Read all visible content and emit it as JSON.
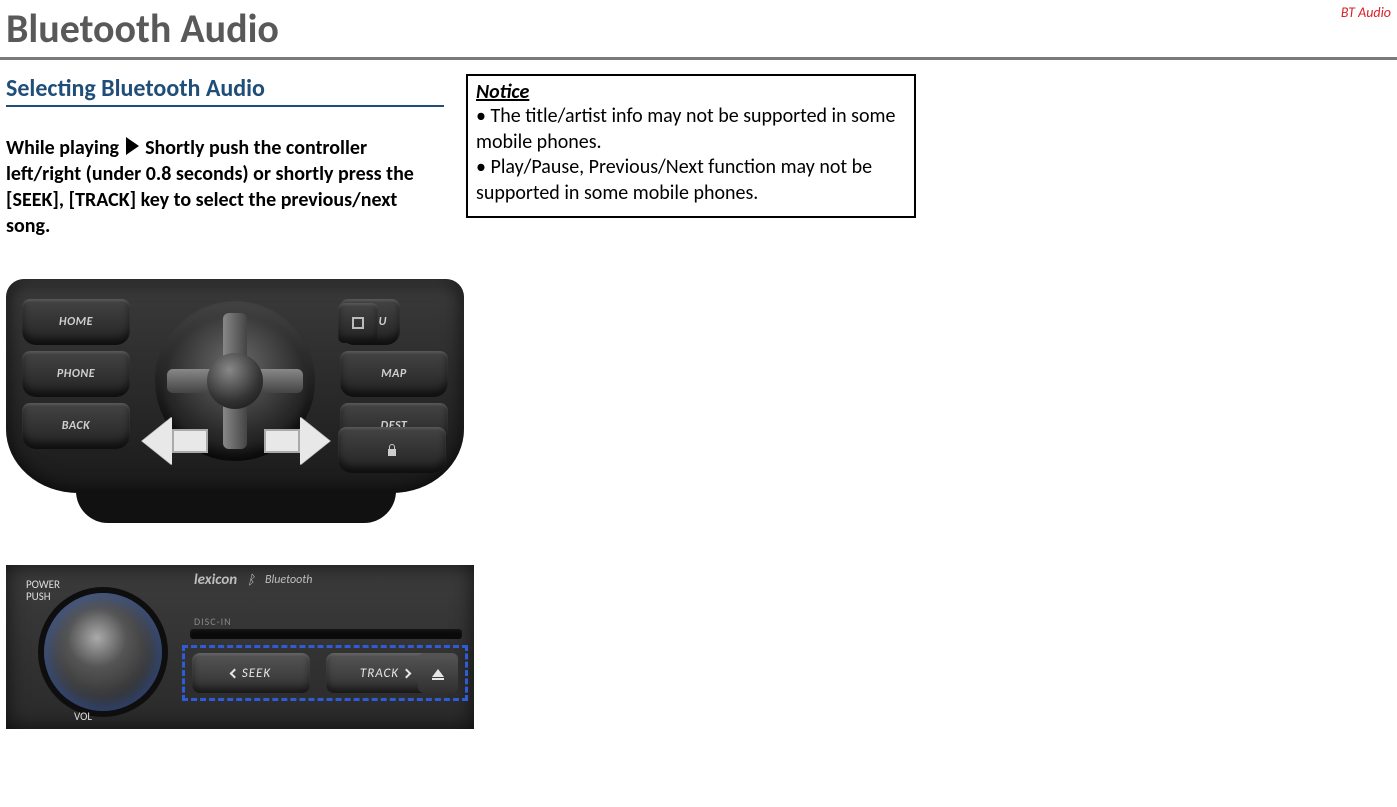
{
  "header": {
    "tag": "BT Audio",
    "title": "Bluetooth Audio"
  },
  "left": {
    "subtitle": "Selecting Bluetooth Audio",
    "body_pre": "While playing ",
    "body_post": " Shortly push the controller left/right (under 0.8 seconds) or shortly press the [SEEK], [TRACK] key to select the previous/next song."
  },
  "controller": {
    "buttons_left": [
      "HOME",
      "PHONE",
      "BACK"
    ],
    "buttons_right": [
      "MENU",
      "MAP",
      "DEST"
    ]
  },
  "radio": {
    "brand": "lexicon",
    "bt_label": "Bluetooth",
    "disc_label": "DISC-IN",
    "power_label": "POWER\nPUSH",
    "vol_label": "VOL",
    "seek_label": "SEEK",
    "track_label": "TRACK"
  },
  "notice": {
    "title": "Notice",
    "items": [
      "• The title/artist info may not be supported in some mobile phones.",
      "• Play/Pause, Previous/Next function may not be supported in some mobile phones."
    ]
  }
}
